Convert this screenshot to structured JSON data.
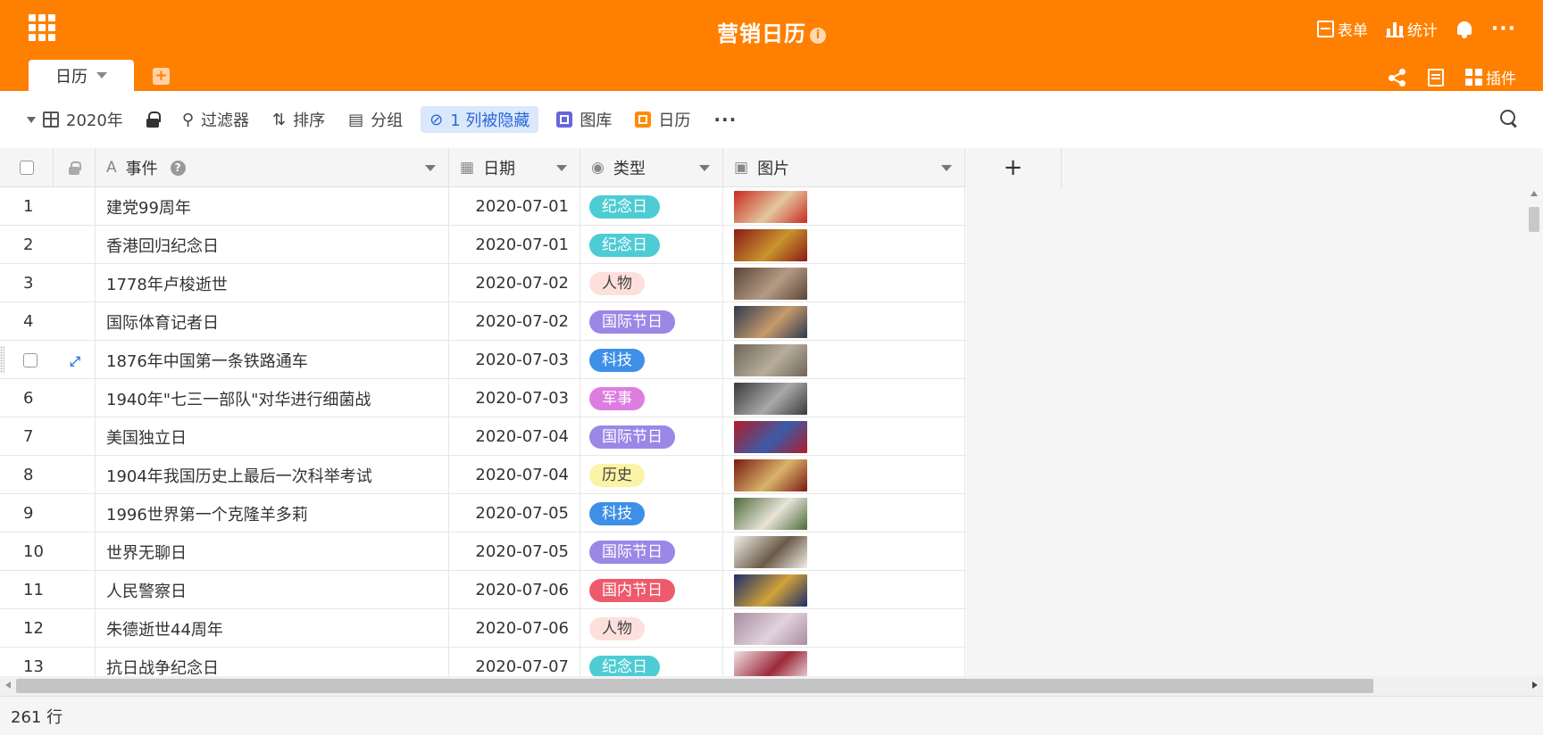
{
  "header": {
    "title": "营销日历",
    "form_label": "表单",
    "stats_label": "统计",
    "plugin_label": "插件",
    "tab_label": "日历",
    "colors": {
      "brand": "#ff8000"
    }
  },
  "toolbar": {
    "table_name": "2020年",
    "filter_label": "过滤器",
    "sort_label": "排序",
    "group_label": "分组",
    "hidden_label": "1 列被隐藏",
    "gallery_label": "图库",
    "calendar_label": "日历"
  },
  "columns": {
    "event": "事件",
    "date": "日期",
    "type": "类型",
    "image": "图片"
  },
  "tag_colors": {
    "纪念日": {
      "bg": "#4dccd4",
      "fg": "#ffffff"
    },
    "人物": {
      "bg": "#fde0dc",
      "fg": "#444444"
    },
    "国际节日": {
      "bg": "#9b87e6",
      "fg": "#ffffff"
    },
    "科技": {
      "bg": "#3d8fe8",
      "fg": "#ffffff"
    },
    "军事": {
      "bg": "#de7de0",
      "fg": "#ffffff"
    },
    "历史": {
      "bg": "#fdf3a6",
      "fg": "#444444"
    },
    "国内节日": {
      "bg": "#ee5a6b",
      "fg": "#ffffff"
    }
  },
  "rows": [
    {
      "idx": "1",
      "event": "建党99周年",
      "date": "2020-07-01",
      "type": "纪念日",
      "img_a": "#c82a1e",
      "img_b": "#e3c7a0"
    },
    {
      "idx": "2",
      "event": "香港回归纪念日",
      "date": "2020-07-01",
      "type": "纪念日",
      "img_a": "#8b1a14",
      "img_b": "#c8942e"
    },
    {
      "idx": "3",
      "event": "1778年卢梭逝世",
      "date": "2020-07-02",
      "type": "人物",
      "img_a": "#5a4536",
      "img_b": "#b59b84"
    },
    {
      "idx": "4",
      "event": "国际体育记者日",
      "date": "2020-07-02",
      "type": "国际节日",
      "img_a": "#2e3b4e",
      "img_b": "#c79a6c"
    },
    {
      "idx": "",
      "event": "1876年中国第一条铁路通车",
      "date": "2020-07-03",
      "type": "科技",
      "img_a": "#6e6558",
      "img_b": "#b7ad9a",
      "hover": true
    },
    {
      "idx": "6",
      "event": "1940年\"七三一部队\"对华进行细菌战",
      "date": "2020-07-03",
      "type": "军事",
      "img_a": "#3a3a3a",
      "img_b": "#a9a9a9"
    },
    {
      "idx": "7",
      "event": "美国独立日",
      "date": "2020-07-04",
      "type": "国际节日",
      "img_a": "#b01c2a",
      "img_b": "#3b5ba8"
    },
    {
      "idx": "8",
      "event": "1904年我国历史上最后一次科举考试",
      "date": "2020-07-04",
      "type": "历史",
      "img_a": "#7a1a12",
      "img_b": "#d9b46a"
    },
    {
      "idx": "9",
      "event": "1996世界第一个克隆羊多莉",
      "date": "2020-07-05",
      "type": "科技",
      "img_a": "#4d6a3a",
      "img_b": "#e8e4d8"
    },
    {
      "idx": "10",
      "event": "世界无聊日",
      "date": "2020-07-05",
      "type": "国际节日",
      "img_a": "#f2efe8",
      "img_b": "#6b5a48"
    },
    {
      "idx": "11",
      "event": "人民警察日",
      "date": "2020-07-06",
      "type": "国内节日",
      "img_a": "#1d2d6b",
      "img_b": "#d0a23a"
    },
    {
      "idx": "12",
      "event": "朱德逝世44周年",
      "date": "2020-07-06",
      "type": "人物",
      "img_a": "#a88da0",
      "img_b": "#e1d2dc"
    },
    {
      "idx": "13",
      "event": "抗日战争纪念日",
      "date": "2020-07-07",
      "type": "纪念日",
      "img_a": "#efe2e6",
      "img_b": "#9c2a3a"
    }
  ],
  "footer": {
    "row_count": "261 行"
  }
}
